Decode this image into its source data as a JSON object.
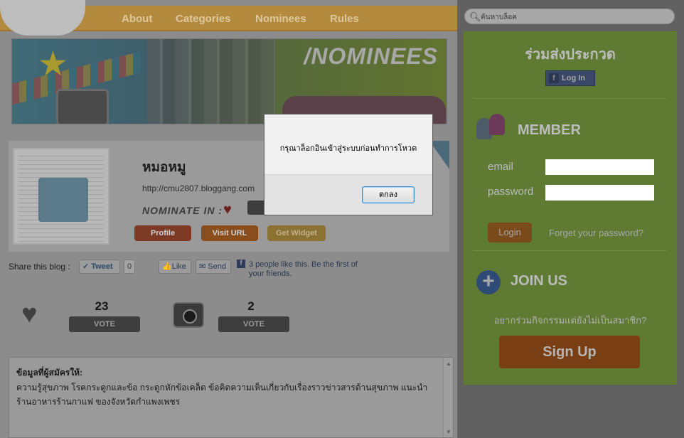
{
  "nav": {
    "items": [
      "About",
      "Categories",
      "Nominees",
      "Rules"
    ]
  },
  "banner": {
    "title": "/NOMINEES"
  },
  "profile": {
    "name": "หมอหมู",
    "url": "http://cmu2807.bloggang.com",
    "nominate_label": "NOMINATE IN :",
    "buttons": {
      "profile": "Profile",
      "visit": "Visit URL",
      "widget": "Get Widget"
    }
  },
  "share": {
    "label": "Share this blog :",
    "tweet": "Tweet",
    "tweet_count": "0",
    "like": "Like",
    "send": "Send",
    "fb_text": "3 people like this. Be the first of your friends."
  },
  "votes": [
    {
      "icon": "heart-icon",
      "count": "23",
      "button": "VOTE"
    },
    {
      "icon": "camera-icon",
      "count": "2",
      "button": "VOTE"
    }
  ],
  "info": {
    "title": "ข้อมูลที่ผู้สมัครให้:",
    "text": "ความรู้สุขภาพ โรคกระดูกและข้อ กระดูกหักข้อเคล็ด ข้อคิดความเห็นเกี่ยวกับเรื่องราวข่าวสารด้านสุขภาพ แนะนำร้านอาหารร้านกาแฟ ของจังหวัดกำแพงเพชร"
  },
  "sidebar": {
    "search_placeholder": "ค้นหาบล็อค",
    "title": "ร่วมส่งประกวด",
    "fb_login": "Log In",
    "member_title": "MEMBER",
    "email_label": "email",
    "password_label": "password",
    "login": "Login",
    "forgot": "Forget your password?",
    "join_title": "JOIN US",
    "join_question": "อยากร่วมกิจกรรมแต่ยังไม่เป็นสมาชิก?",
    "signup": "Sign Up"
  },
  "dialog": {
    "message": "กรุณาล็อกอินเข้าสู่ระบบก่อนทำการโหวต",
    "ok": "ตกลง"
  }
}
